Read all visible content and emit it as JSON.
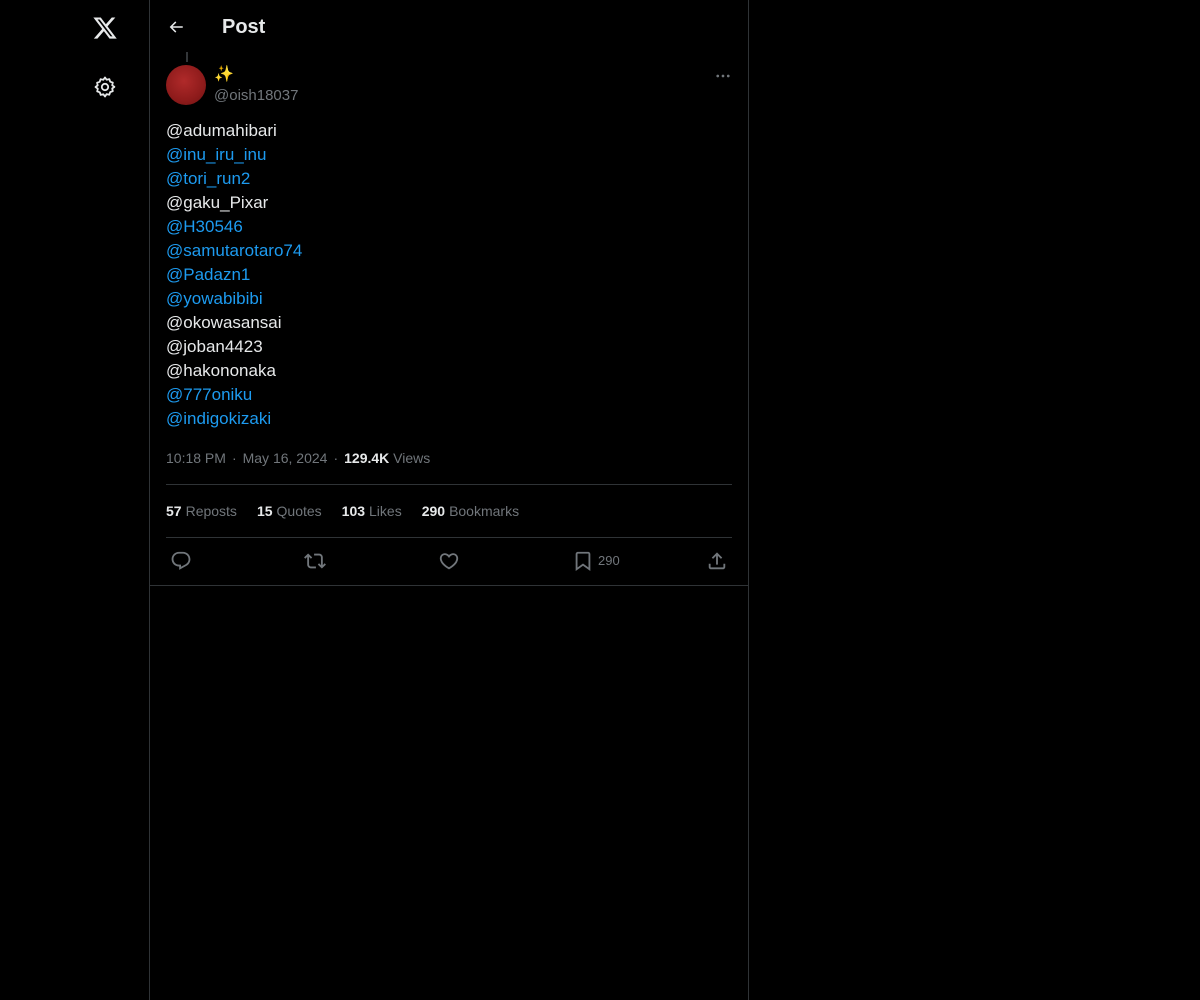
{
  "sidebar": {
    "logo_icon": "x-logo-icon",
    "settings_icon": "gear-icon"
  },
  "header": {
    "title": "Post",
    "back_icon": "arrow-left-icon"
  },
  "post": {
    "author": {
      "display_name": "✨",
      "handle": "@oish18037"
    },
    "mentions": [
      {
        "text": "@adumahibari",
        "link": false
      },
      {
        "text": "@inu_iru_inu",
        "link": true
      },
      {
        "text": "@tori_run2",
        "link": true
      },
      {
        "text": "@gaku_Pixar",
        "link": false
      },
      {
        "text": "@H30546",
        "link": true
      },
      {
        "text": "@samutarotaro74",
        "link": true
      },
      {
        "text": "@Padazn1",
        "link": true
      },
      {
        "text": "@yowabibibi",
        "link": true
      },
      {
        "text": "@okowasansai",
        "link": false
      },
      {
        "text": "@joban4423",
        "link": false
      },
      {
        "text": "@hakononaka",
        "link": false
      },
      {
        "text": "@777oniku",
        "link": true
      },
      {
        "text": "@indigokizaki",
        "link": true
      }
    ],
    "time": "10:18 PM",
    "date": "May 16, 2024",
    "separator": "·",
    "views_count": "129.4K",
    "views_label": "Views",
    "stats": {
      "reposts_count": "57",
      "reposts_label": "Reposts",
      "quotes_count": "15",
      "quotes_label": "Quotes",
      "likes_count": "103",
      "likes_label": "Likes",
      "bookmarks_count": "290",
      "bookmarks_label": "Bookmarks"
    },
    "actions": {
      "bookmark_count": "290"
    }
  },
  "colors": {
    "background": "#000000",
    "text": "#e7e9ea",
    "muted": "#71767b",
    "link": "#1d9bf0",
    "border": "#2f3336",
    "avatar": "#8e1b1b"
  }
}
